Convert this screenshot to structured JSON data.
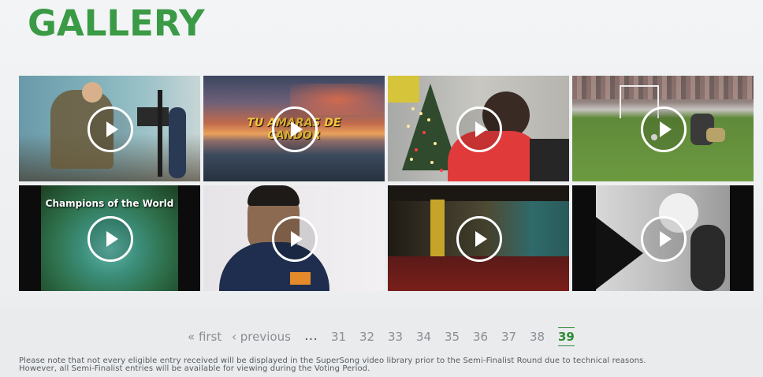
{
  "gallery": {
    "title": "GALLERY",
    "thumbnails": [
      {
        "name": "video-guitar-studio",
        "overlay": "",
        "play_icon": "play-icon"
      },
      {
        "name": "video-sunset-sea",
        "overlay": "TU AMARAS DE CANDOR",
        "play_icon": "play-icon"
      },
      {
        "name": "video-christmas-tree",
        "overlay": "",
        "play_icon": "play-icon"
      },
      {
        "name": "video-football-match",
        "overlay": "",
        "play_icon": "play-icon"
      },
      {
        "name": "video-champions-of-the-world",
        "overlay": "Champions of the World",
        "play_icon": "play-icon"
      },
      {
        "name": "video-singer-portrait",
        "overlay": "",
        "play_icon": "play-icon"
      },
      {
        "name": "video-dark-room",
        "overlay": "",
        "play_icon": "play-icon"
      },
      {
        "name": "video-black-and-white",
        "overlay": "",
        "play_icon": "play-icon"
      }
    ]
  },
  "pagination": {
    "first": "« first",
    "previous": "‹ previous",
    "ellipsis": "…",
    "pages": [
      "31",
      "32",
      "33",
      "34",
      "35",
      "36",
      "37",
      "38"
    ],
    "current": "39"
  },
  "note": {
    "line1": "Please note that not every eligible entry received will be displayed in the SuperSong video library prior to the Semi-Finalist Round due to technical reasons.",
    "line2": "However, all Semi-Finalist entries will be available for viewing during the Voting Period."
  },
  "colors": {
    "title": "#3a9a45",
    "current_page": "#2f8a33",
    "page_link": "#8a8f94"
  }
}
